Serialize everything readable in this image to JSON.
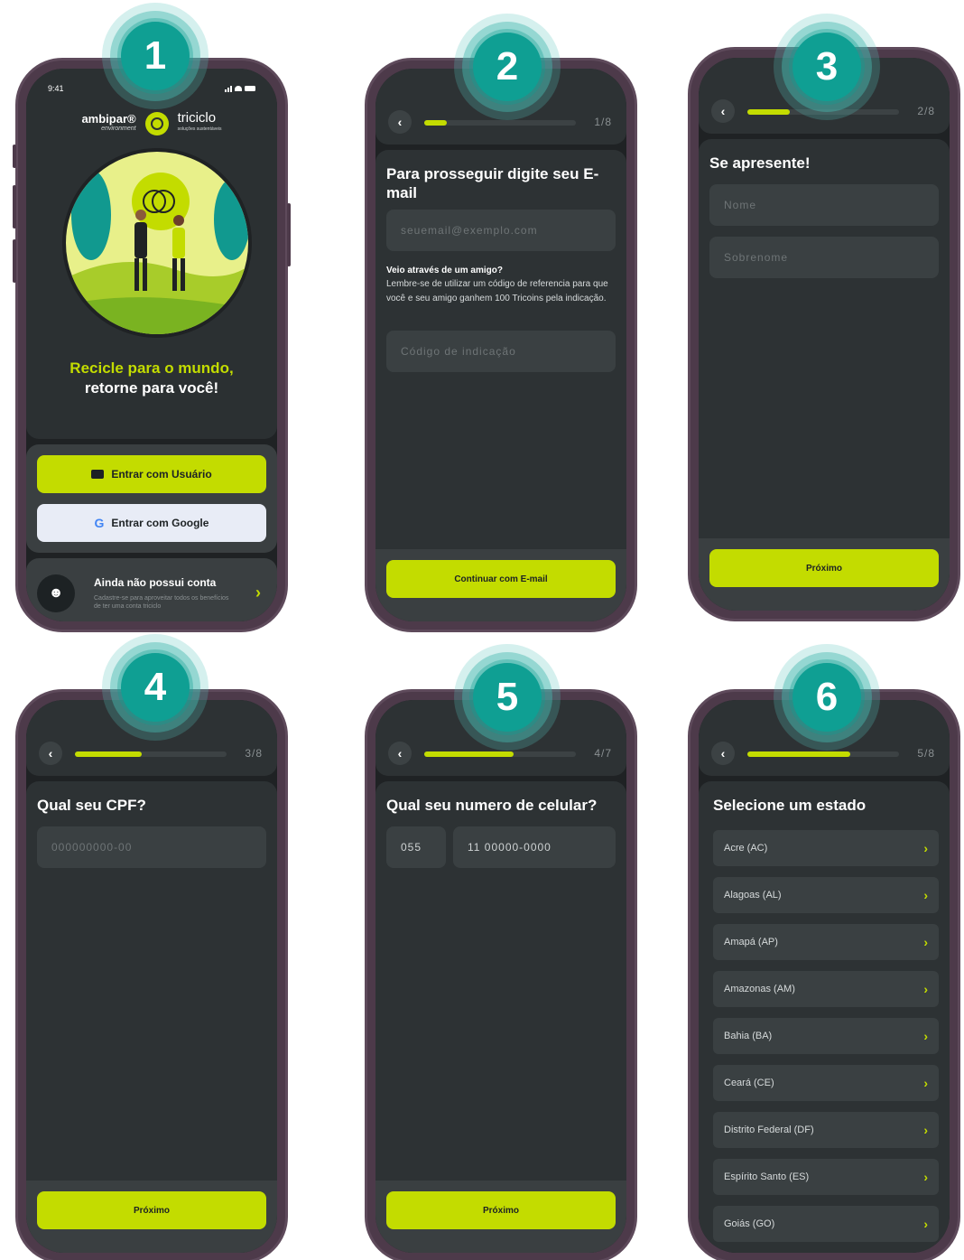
{
  "status": {
    "time": "9:41"
  },
  "badges": [
    "1",
    "2",
    "3",
    "4",
    "5",
    "6"
  ],
  "screen1": {
    "brand_left": "ambipar®",
    "brand_left_sub": "environment",
    "brand_right": "triciclo",
    "brand_right_sub": "soluções sustentáveis",
    "hero_line1": "Recicle para o mundo,",
    "hero_line2": "retorne para você!",
    "btn_user": "Entrar com Usuário",
    "btn_google": "Entrar com Google",
    "account_title": "Ainda não possui conta",
    "account_sub": "Cadastre-se para aproveitar todos os benefícios de ter uma conta triciclo"
  },
  "screen2": {
    "step": "1/8",
    "progress": 0.15,
    "title": "Para prosseguir digite seu E-mail",
    "email_placeholder": "seuemail@exemplo.com",
    "hint_title": "Veio através de um amigo?",
    "hint_body": "Lembre-se de utilizar um código de referencia para que você e seu amigo ganhem 100 Tricoins pela indicação.",
    "code_placeholder": "Código de indicação",
    "cta": "Continuar com E-mail"
  },
  "screen3": {
    "step": "2/8",
    "progress": 0.28,
    "title": "Se apresente!",
    "first_name_placeholder": "Nome",
    "last_name_placeholder": "Sobrenome",
    "cta": "Próximo"
  },
  "screen4": {
    "step": "3/8",
    "progress": 0.44,
    "title": "Qual seu CPF?",
    "cpf_placeholder": "000000000-00",
    "cta": "Próximo"
  },
  "screen5": {
    "step": "4/7",
    "progress": 0.59,
    "title": "Qual seu numero de celular?",
    "country_code": "055",
    "phone_value": "11 00000-0000",
    "cta": "Próximo"
  },
  "screen6": {
    "step": "5/8",
    "progress": 0.68,
    "title": "Selecione um estado",
    "states": [
      "Acre (AC)",
      "Alagoas (AL)",
      "Amapá (AP)",
      "Amazonas (AM)",
      "Bahia (BA)",
      "Ceará (CE)",
      "Distrito Federal (DF)",
      "Espírito Santo (ES)",
      "Goiás (GO)"
    ]
  }
}
